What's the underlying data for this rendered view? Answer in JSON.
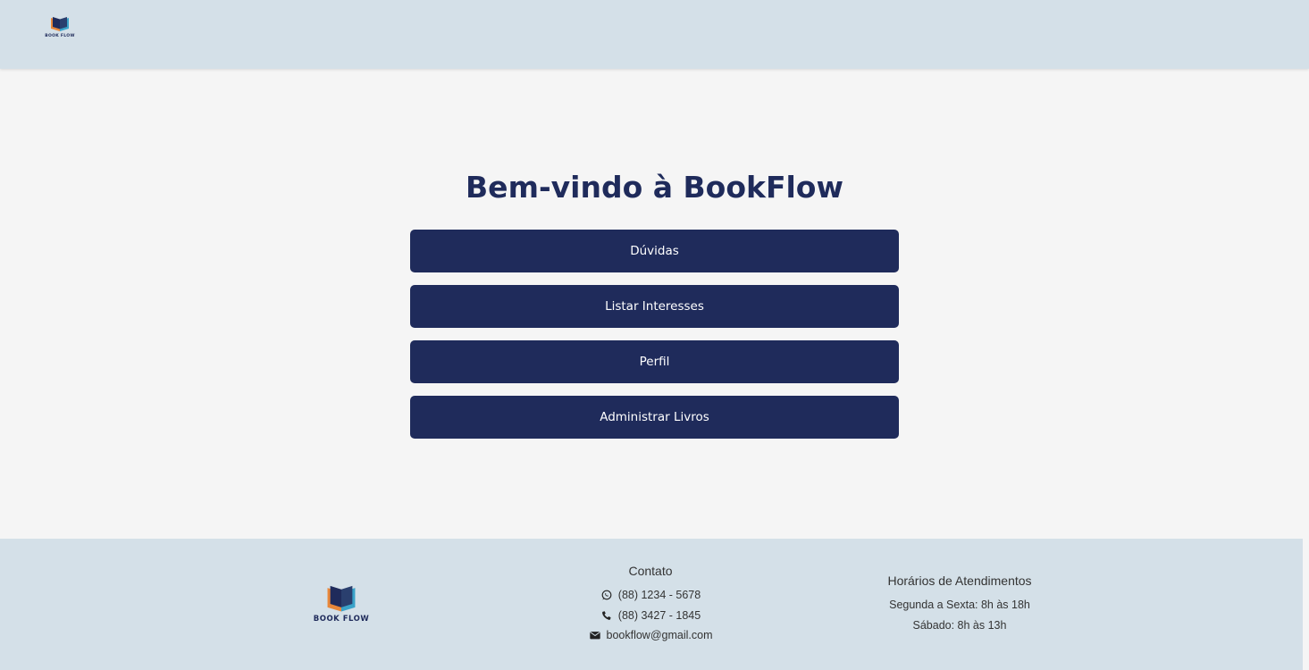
{
  "brand": {
    "logo_text": "BOOK FLOW",
    "colors": {
      "navy": "#1f2b5b",
      "header_bg": "#d4e0e8",
      "page_bg": "#f5f5f5",
      "book_orange": "#e8873a",
      "book_teal": "#3aa3c9"
    }
  },
  "main": {
    "title": "Bem-vindo à BookFlow",
    "buttons": [
      {
        "label": "Dúvidas"
      },
      {
        "label": "Listar Interesses"
      },
      {
        "label": "Perfil"
      },
      {
        "label": "Administrar Livros"
      }
    ]
  },
  "footer": {
    "contact": {
      "heading": "Contato",
      "whatsapp": "(88) 1234 - 5678",
      "phone": "(88) 3427 - 1845",
      "email": "bookflow@gmail.com",
      "icons": [
        "whatsapp-icon",
        "phone-icon",
        "envelope-icon"
      ]
    },
    "hours": {
      "heading": "Horários de Atendimentos",
      "weekdays": "Segunda a Sexta: 8h às 18h",
      "saturday": "Sábado: 8h às 13h"
    }
  }
}
